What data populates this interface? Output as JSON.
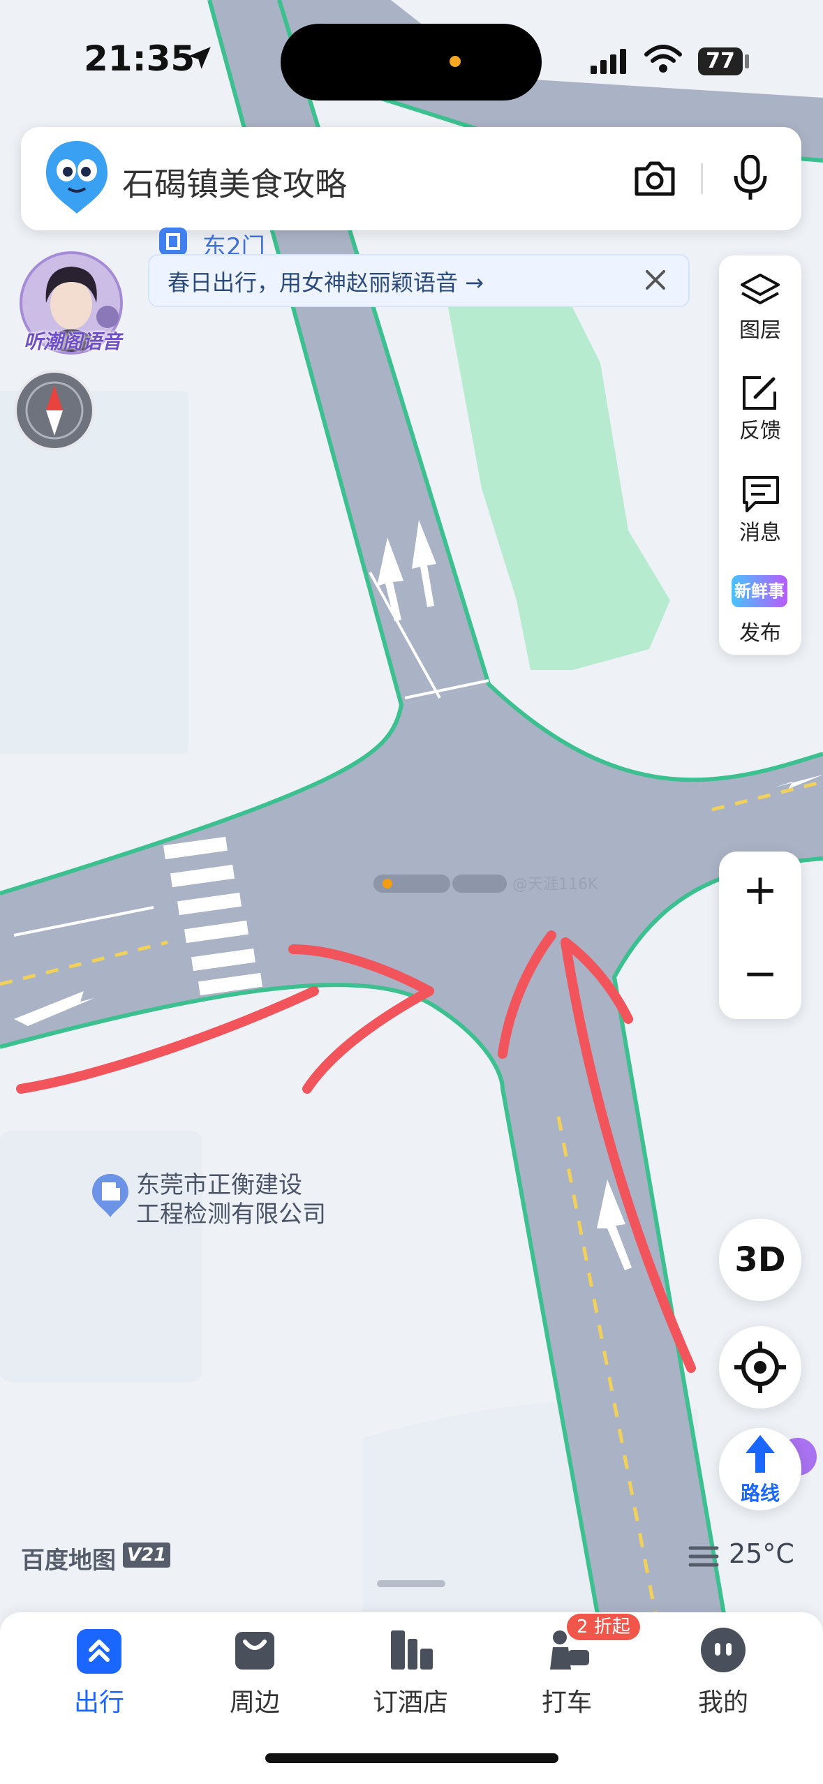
{
  "status": {
    "time": "21:35",
    "battery": "77"
  },
  "search": {
    "query": "石碣镇美食攻略"
  },
  "voice_pack": {
    "label": "听潮阁语音"
  },
  "poi_top": {
    "label": "东2门"
  },
  "promo": {
    "text": "春日出行，用女神赵丽颖语音 →"
  },
  "side_tools": [
    {
      "label": "图层",
      "icon": "layers-icon"
    },
    {
      "label": "反馈",
      "icon": "edit-icon"
    },
    {
      "label": "消息",
      "icon": "message-icon"
    },
    {
      "label": "发布",
      "icon": "publish-icon",
      "badge": "新鲜事"
    }
  ],
  "zoom": {
    "in": "+",
    "out": "−"
  },
  "map_poi": {
    "line1": "东莞市正衡建设",
    "line2": "工程检测有限公司"
  },
  "watermark": {
    "text": "@天涯116K"
  },
  "btn_3d": "3D",
  "route": {
    "label": "路线"
  },
  "brand": {
    "name": "百度地图",
    "version": "V21"
  },
  "weather": {
    "temp": "25°C"
  },
  "tabs": [
    {
      "label": "出行",
      "active": true,
      "icon": "travel-icon"
    },
    {
      "label": "周边",
      "active": false,
      "icon": "nearby-icon"
    },
    {
      "label": "订酒店",
      "active": false,
      "icon": "hotel-icon"
    },
    {
      "label": "打车",
      "active": false,
      "icon": "taxi-icon",
      "badge": "2 折起"
    },
    {
      "label": "我的",
      "active": false,
      "icon": "profile-icon"
    }
  ],
  "colors": {
    "accent": "#1a66ff",
    "road": "#aab2c5",
    "road_edge": "#3cc08f",
    "green": "#b6ebcf",
    "arrow_annotation": "#f2545b",
    "background": "#eef2f7"
  }
}
